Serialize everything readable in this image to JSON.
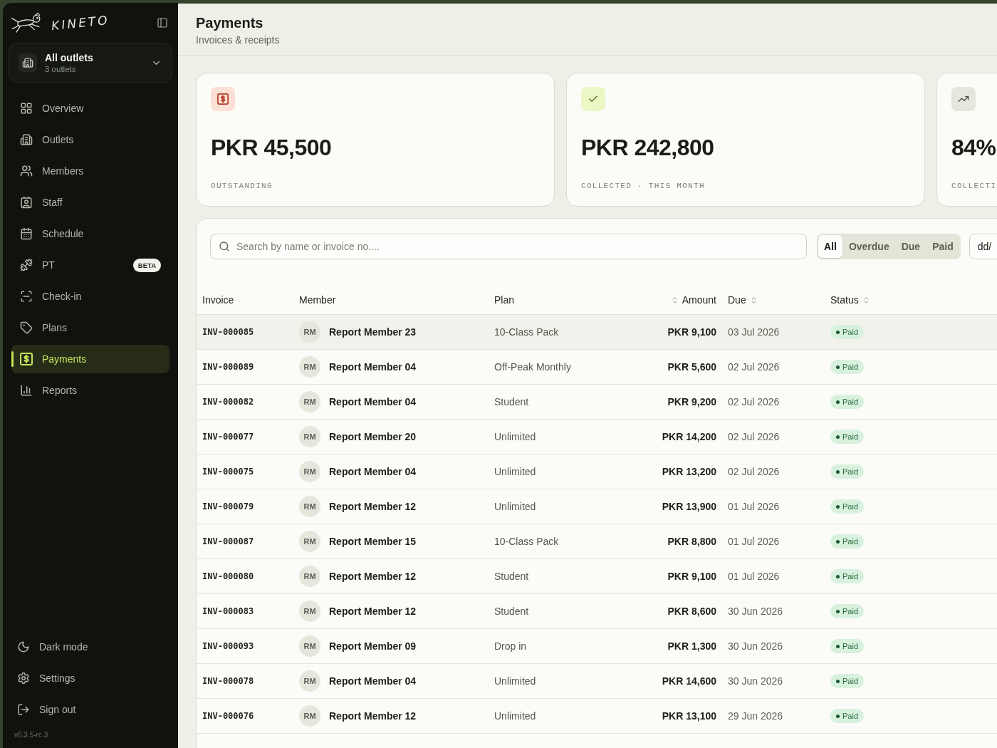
{
  "sidebar": {
    "brand": "KINETO",
    "outlet_selector": {
      "title": "All outlets",
      "subtitle": "3 outlets"
    },
    "nav": [
      {
        "label": "Overview",
        "selected": false
      },
      {
        "label": "Outlets",
        "selected": false
      },
      {
        "label": "Members",
        "selected": false
      },
      {
        "label": "Staff",
        "selected": false
      },
      {
        "label": "Schedule",
        "selected": false
      },
      {
        "label": "PT",
        "selected": false,
        "badge": "BETA"
      },
      {
        "label": "Check-in",
        "selected": false
      },
      {
        "label": "Plans",
        "selected": false
      },
      {
        "label": "Payments",
        "selected": true
      },
      {
        "label": "Reports",
        "selected": false
      }
    ],
    "footer_items": [
      {
        "label": "Dark mode"
      },
      {
        "label": "Settings"
      },
      {
        "label": "Sign out"
      }
    ],
    "version": "v0.3.5-rc.3"
  },
  "header": {
    "title": "Payments",
    "subtitle": "Invoices & receipts"
  },
  "stat_cards": [
    {
      "kind": "outstanding",
      "value": "PKR 45,500",
      "label": "OUTSTANDING"
    },
    {
      "kind": "collected",
      "value": "PKR 242,800",
      "label": "COLLECTED · THIS MONTH"
    },
    {
      "kind": "rate",
      "value": "84%",
      "label": "COLLECTI"
    }
  ],
  "search": {
    "placeholder": "Search by name or invoice no...."
  },
  "filters": [
    {
      "label": "All",
      "selected": true
    },
    {
      "label": "Overdue",
      "selected": false
    },
    {
      "label": "Due",
      "selected": false
    },
    {
      "label": "Paid",
      "selected": false
    }
  ],
  "date_field": {
    "placeholder": "dd/"
  },
  "table": {
    "columns": [
      {
        "label": "Invoice",
        "sortable": false
      },
      {
        "label": "Member",
        "sortable": false
      },
      {
        "label": "Plan",
        "sortable": false
      },
      {
        "label": "Amount",
        "sortable": true
      },
      {
        "label": "Due",
        "sortable": true
      },
      {
        "label": "Status",
        "sortable": true
      }
    ],
    "rows": [
      {
        "selected": true,
        "invoice": "INV-000085",
        "initials": "RM",
        "member": "Report Member 23",
        "plan": "10-Class Pack",
        "amount": "PKR 9,100",
        "due": "03 Jul 2026",
        "status": {
          "kind": "paid",
          "label": "Paid"
        }
      },
      {
        "selected": false,
        "invoice": "INV-000089",
        "initials": "RM",
        "member": "Report Member 04",
        "plan": "Off-Peak Monthly",
        "amount": "PKR 5,600",
        "due": "02 Jul 2026",
        "status": {
          "kind": "paid",
          "label": "Paid"
        }
      },
      {
        "selected": false,
        "invoice": "INV-000082",
        "initials": "RM",
        "member": "Report Member 04",
        "plan": "Student",
        "amount": "PKR 9,200",
        "due": "02 Jul 2026",
        "status": {
          "kind": "paid",
          "label": "Paid"
        }
      },
      {
        "selected": false,
        "invoice": "INV-000077",
        "initials": "RM",
        "member": "Report Member 20",
        "plan": "Unlimited",
        "amount": "PKR 14,200",
        "due": "02 Jul 2026",
        "status": {
          "kind": "paid",
          "label": "Paid"
        }
      },
      {
        "selected": false,
        "invoice": "INV-000075",
        "initials": "RM",
        "member": "Report Member 04",
        "plan": "Unlimited",
        "amount": "PKR 13,200",
        "due": "02 Jul 2026",
        "status": {
          "kind": "paid",
          "label": "Paid"
        }
      },
      {
        "selected": false,
        "invoice": "INV-000079",
        "initials": "RM",
        "member": "Report Member 12",
        "plan": "Unlimited",
        "amount": "PKR 13,900",
        "due": "01 Jul 2026",
        "status": {
          "kind": "paid",
          "label": "Paid"
        }
      },
      {
        "selected": false,
        "invoice": "INV-000087",
        "initials": "RM",
        "member": "Report Member 15",
        "plan": "10-Class Pack",
        "amount": "PKR 8,800",
        "due": "01 Jul 2026",
        "status": {
          "kind": "paid",
          "label": "Paid"
        }
      },
      {
        "selected": false,
        "invoice": "INV-000080",
        "initials": "RM",
        "member": "Report Member 12",
        "plan": "Student",
        "amount": "PKR 9,100",
        "due": "01 Jul 2026",
        "status": {
          "kind": "paid",
          "label": "Paid"
        }
      },
      {
        "selected": false,
        "invoice": "INV-000083",
        "initials": "RM",
        "member": "Report Member 12",
        "plan": "Student",
        "amount": "PKR 8,600",
        "due": "30 Jun 2026",
        "status": {
          "kind": "paid",
          "label": "Paid"
        }
      },
      {
        "selected": false,
        "invoice": "INV-000093",
        "initials": "RM",
        "member": "Report Member 09",
        "plan": "Drop in",
        "amount": "PKR 1,300",
        "due": "30 Jun 2026",
        "status": {
          "kind": "paid",
          "label": "Paid"
        }
      },
      {
        "selected": false,
        "invoice": "INV-000078",
        "initials": "RM",
        "member": "Report Member 04",
        "plan": "Unlimited",
        "amount": "PKR 14,600",
        "due": "30 Jun 2026",
        "status": {
          "kind": "paid",
          "label": "Paid"
        }
      },
      {
        "selected": false,
        "invoice": "INV-000076",
        "initials": "RM",
        "member": "Report Member 12",
        "plan": "Unlimited",
        "amount": "PKR 13,100",
        "due": "29 Jun 2026",
        "status": {
          "kind": "paid",
          "label": "Paid"
        }
      }
    ]
  }
}
